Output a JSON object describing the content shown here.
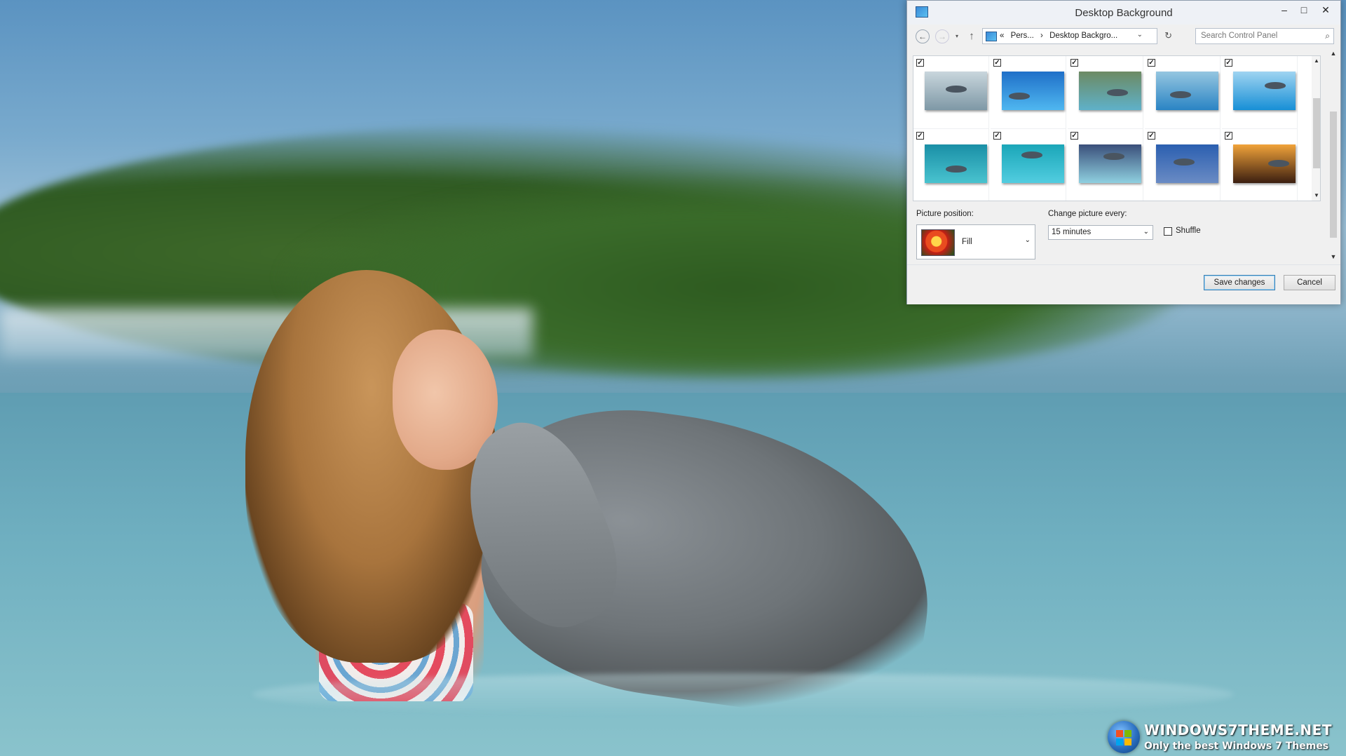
{
  "window": {
    "title": "Desktop Background",
    "controls": {
      "minimize": "–",
      "maximize": "□",
      "close": "✕"
    }
  },
  "nav": {
    "back_icon": "←",
    "forward_icon": "→",
    "recent_icon": "▾",
    "up_icon": "↑",
    "breadcrumb": [
      "«",
      "Pers...",
      "›",
      "Desktop Backgro..."
    ],
    "dropdown_icon": "⌄",
    "refresh_icon": "↻",
    "search_placeholder": "Search Control Panel",
    "search_icon": "⌕"
  },
  "thumbnails": [
    {
      "checked": true,
      "colors": [
        "#c9d6dd",
        "#7e98a6"
      ]
    },
    {
      "checked": true,
      "colors": [
        "#1f6fc8",
        "#4fb7f0"
      ]
    },
    {
      "checked": true,
      "colors": [
        "#6c8a63",
        "#5fb1c9"
      ]
    },
    {
      "checked": true,
      "colors": [
        "#95c6e0",
        "#2a84c4"
      ]
    },
    {
      "checked": true,
      "colors": [
        "#9fd4f1",
        "#178fd6"
      ]
    },
    {
      "checked": true,
      "colors": [
        "#1a8fa6",
        "#49c3cf"
      ]
    },
    {
      "checked": true,
      "colors": [
        "#1aa6b8",
        "#52cde0"
      ]
    },
    {
      "checked": true,
      "colors": [
        "#3a4f7a",
        "#8fd0e0"
      ]
    },
    {
      "checked": true,
      "colors": [
        "#2b5fb0",
        "#6a8bc4"
      ]
    },
    {
      "checked": true,
      "colors": [
        "#f1a33a",
        "#3b1e10"
      ]
    }
  ],
  "picture_position": {
    "label": "Picture position:",
    "value": "Fill"
  },
  "change_picture": {
    "label": "Change picture every:",
    "value": "15 minutes"
  },
  "shuffle": {
    "label": "Shuffle",
    "checked": false
  },
  "buttons": {
    "save": "Save changes",
    "cancel": "Cancel"
  },
  "watermark_logo": {
    "text": "WINDOWS7THEME.NET",
    "tagline": "Only the best Windows 7 Themes"
  },
  "colors": {
    "accent": "#3c7fb1",
    "window_bg": "#f0f0f0"
  }
}
